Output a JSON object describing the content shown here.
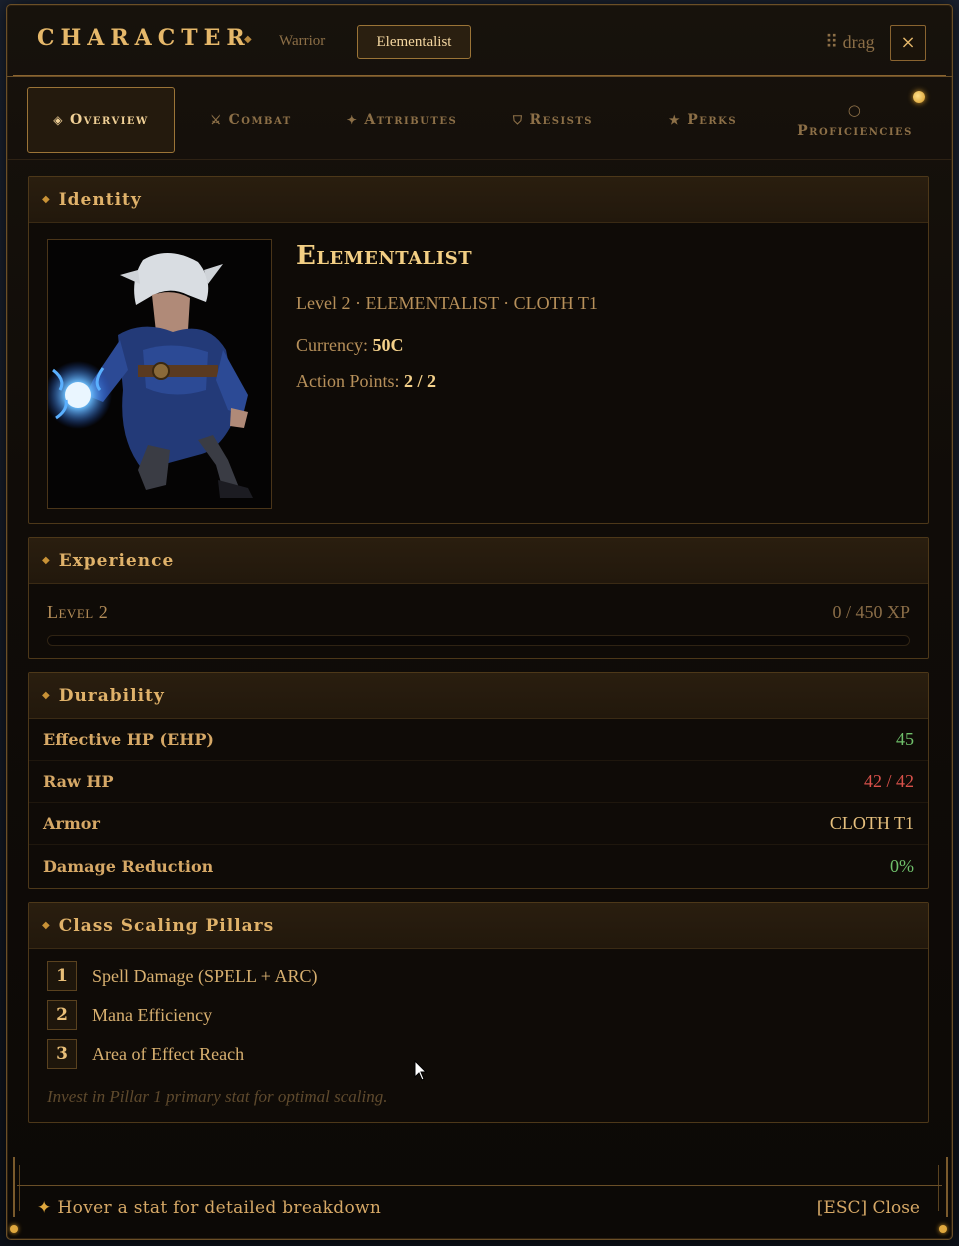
{
  "header": {
    "title": "CHARACTER",
    "class_tabs": [
      "Warrior",
      "Elementalist"
    ],
    "active_class": "Elementalist",
    "drag_label": "⠿ drag",
    "close_symbol": "×"
  },
  "tabs": [
    {
      "label": "Overview",
      "icon": "◈",
      "icon_name": "diamond-icon",
      "active": true
    },
    {
      "label": "Combat",
      "icon": "⚔",
      "icon_name": "swords-icon",
      "active": false
    },
    {
      "label": "Attributes",
      "icon": "✦",
      "icon_name": "star-burst-icon",
      "active": false
    },
    {
      "label": "Resists",
      "icon": "⛉",
      "icon_name": "shield-icon",
      "active": false
    },
    {
      "label": "Perks",
      "icon": "★",
      "icon_name": "star-icon",
      "active": false
    },
    {
      "label": "Proficiencies",
      "icon": "○",
      "icon_name": "circle-icon",
      "active": false
    }
  ],
  "identity": {
    "section_title": "Identity",
    "name": "Elementalist",
    "subtitle": "Level 2 · ELEMENTALIST · CLOTH T1",
    "currency_label": "Currency:",
    "currency_value": "50C",
    "ap_label": "Action Points:",
    "ap_value": "2 / 2"
  },
  "experience": {
    "section_title": "Experience",
    "level_label": "Level 2",
    "xp_text": "0 / 450 XP",
    "progress_fraction": 0.0
  },
  "durability": {
    "section_title": "Durability",
    "rows": [
      {
        "label": "Effective HP (EHP)",
        "value": "45",
        "color": "#6fbf6a"
      },
      {
        "label": "Raw HP",
        "value": "42 / 42",
        "color": "#d9514a"
      },
      {
        "label": "Armor",
        "value": "CLOTH T1",
        "color": "#e6c07e"
      },
      {
        "label": "Damage Reduction",
        "value": "0%",
        "color": "#6fbf6a"
      }
    ]
  },
  "pillars": {
    "section_title": "Class Scaling Pillars",
    "items": [
      {
        "num": "1",
        "text": "Spell Damage (SPELL + ARC)"
      },
      {
        "num": "2",
        "text": "Mana Efficiency"
      },
      {
        "num": "3",
        "text": "Area of Effect Reach"
      }
    ],
    "hint": "Invest in Pillar 1 primary stat for optimal scaling."
  },
  "footer": {
    "hint": "Hover a stat for detailed breakdown",
    "close": "[ESC] Close"
  },
  "colors": {
    "accent": "#e0b26a",
    "border": "#6b4f27",
    "notify": "#d69a28"
  }
}
